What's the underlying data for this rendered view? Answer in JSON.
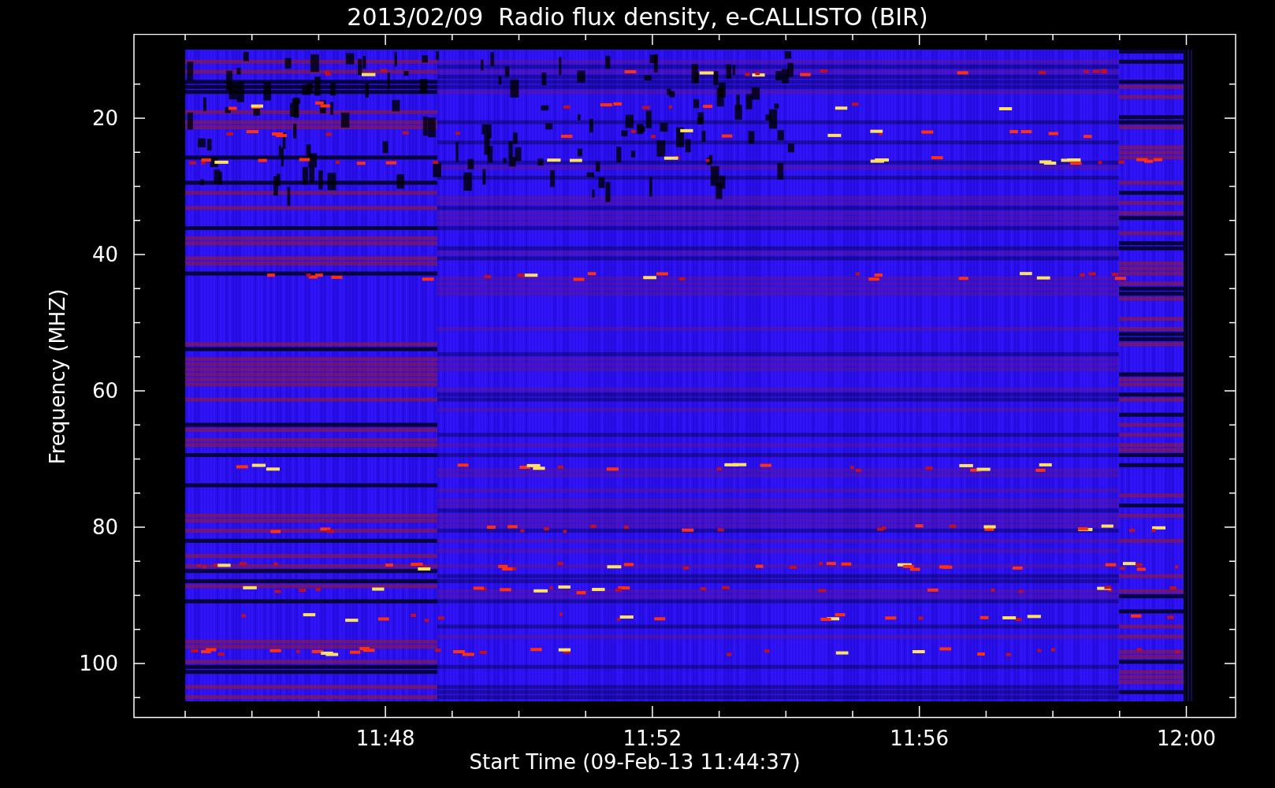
{
  "title": "2013/02/09  Radio flux density, e-CALLISTO (BIR)",
  "y_axis": {
    "label": "Frequency (MHZ)",
    "ticks": [
      "20",
      "40",
      "60",
      "80",
      "100"
    ]
  },
  "x_axis": {
    "label": "Start Time (09-Feb-13 11:44:37)",
    "ticks": [
      "11:48",
      "11:52",
      "11:56",
      "12:00"
    ]
  }
}
